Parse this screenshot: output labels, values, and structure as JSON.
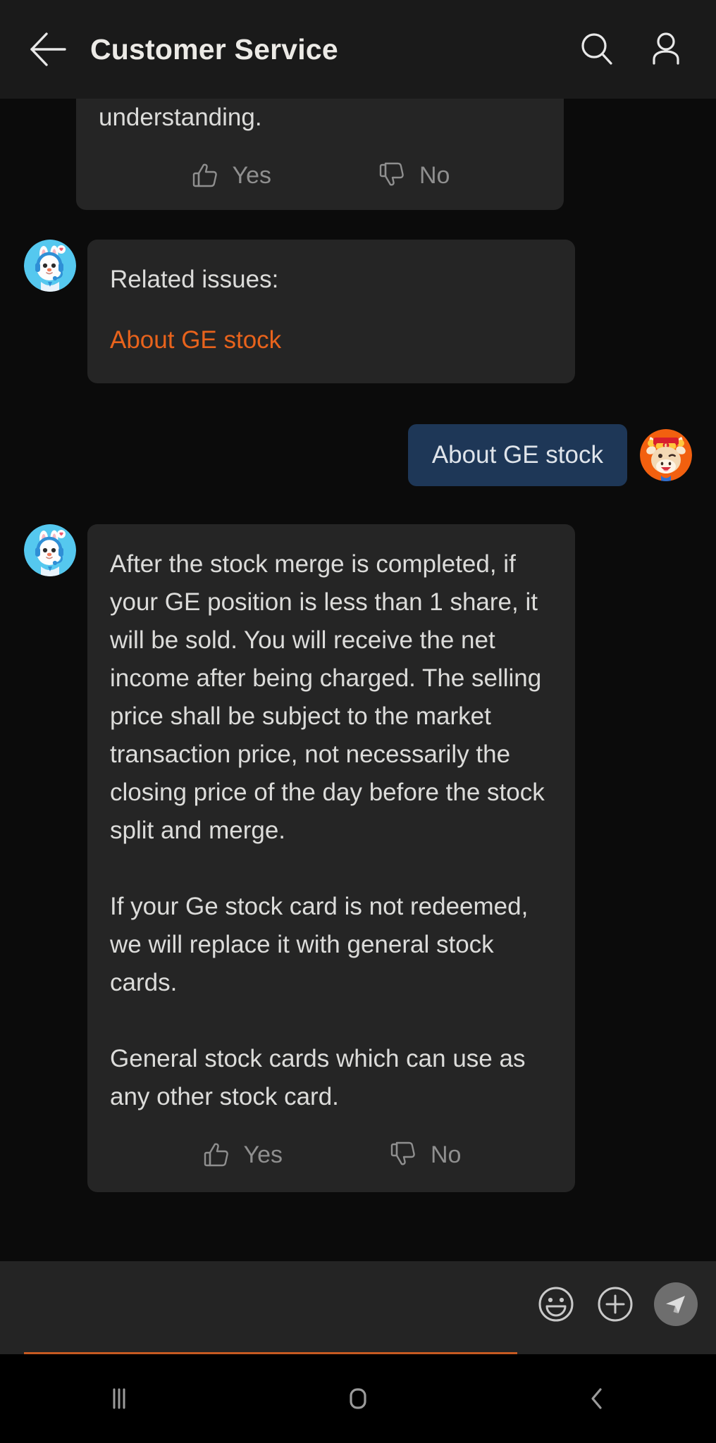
{
  "header": {
    "back_icon": "back-arrow-icon",
    "title": "Customer Service",
    "search_icon": "search-icon",
    "profile_icon": "person-icon"
  },
  "chat": {
    "messages": [
      {
        "sender": "bot",
        "clipped": true,
        "text": "understanding.",
        "feedback": {
          "yes_label": "Yes",
          "no_label": "No"
        }
      },
      {
        "sender": "bot",
        "avatar": "bunny-support-avatar",
        "text": "Related issues:",
        "link": "About GE stock"
      },
      {
        "sender": "user",
        "avatar": "cow-user-avatar",
        "text": "About GE stock"
      },
      {
        "sender": "bot",
        "avatar": "bunny-support-avatar",
        "paragraphs": [
          "After the stock merge is completed, if your GE position is less than 1 share, it will be sold. You will receive the net income after being charged. The selling price shall be subject to the market transaction price, not necessarily the closing price of the day before the stock split and merge.",
          "If your Ge stock card is not redeemed, we will replace it with general stock cards.",
          "General stock cards which can use as any other stock card."
        ],
        "feedback": {
          "yes_label": "Yes",
          "no_label": "No"
        }
      }
    ]
  },
  "input_bar": {
    "value": "",
    "placeholder": "",
    "emoji_icon": "smiley-icon",
    "add_icon": "plus-icon",
    "send_icon": "send-icon"
  },
  "nav_bar": {
    "recents_icon": "recents-icon",
    "home_icon": "home-icon",
    "back_icon": "back-chevron-icon"
  },
  "colors": {
    "page_bg": "#0b0b0b",
    "header_bg": "#1a1a1a",
    "bubble_bg": "#252525",
    "user_bubble_bg": "#1e3757",
    "link_orange": "#e8631c",
    "input_underline": "#c65a22",
    "text_primary": "#dcdcda",
    "text_muted": "#8f8f8f"
  }
}
